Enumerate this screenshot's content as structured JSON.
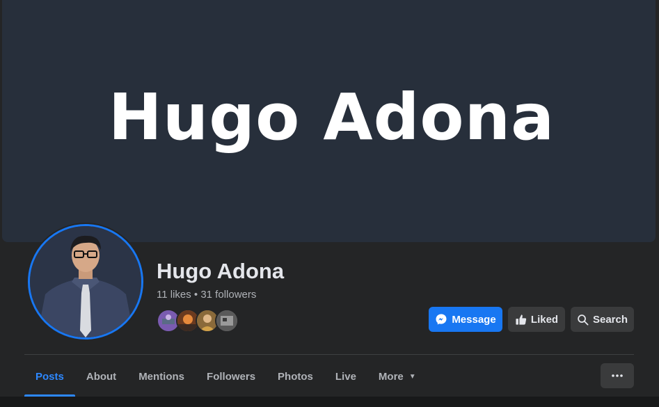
{
  "cover": {
    "title": "Hugo Adona"
  },
  "profile": {
    "name": "Hugo Adona",
    "stats": "11 likes • 31 followers",
    "follower_avatar_count": 4
  },
  "actions": {
    "message_label": "Message",
    "liked_label": "Liked",
    "search_label": "Search"
  },
  "tabs": [
    {
      "label": "Posts",
      "active": true
    },
    {
      "label": "About"
    },
    {
      "label": "Mentions"
    },
    {
      "label": "Followers"
    },
    {
      "label": "Photos"
    },
    {
      "label": "Live"
    },
    {
      "label": "More"
    }
  ],
  "icons": {
    "message": "messenger-icon",
    "liked": "thumbs-up-icon",
    "search": "search-icon",
    "more_tab": "caret-down-icon",
    "overflow": "more-horizontal-icon"
  },
  "colors": {
    "accent": "#1877f2",
    "active_tab": "#2d88ff",
    "cover_bg": "#272f3b",
    "surface": "#242526",
    "button_secondary": "#3a3b3c"
  }
}
